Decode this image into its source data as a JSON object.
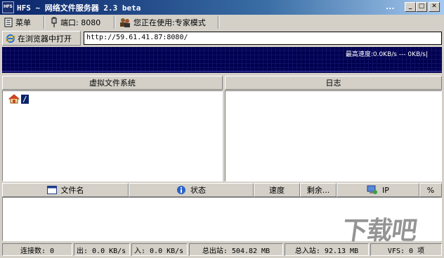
{
  "window": {
    "icon_label": "HFS",
    "title": "HFS ~ 网络文件服务器 2.3 beta",
    "dots": "...",
    "min_glyph": "_",
    "max_glyph": "□",
    "close_glyph": "✕"
  },
  "toolbar": {
    "menu": "菜单",
    "port": "端口: 8080",
    "mode": "您正在使用:专家模式"
  },
  "urlbar": {
    "open_browser": "在浏览器中打开",
    "url": "http://59.61.41.87:8080/"
  },
  "graph": {
    "speed_text": "最高速度:0.0KB/s  ---  0KB/s|"
  },
  "vfs": {
    "header": "虚拟文件系统",
    "root": "/"
  },
  "log": {
    "header": "日志"
  },
  "list": {
    "columns": [
      "文件名",
      "状态",
      "速度",
      "剩余...",
      "IP",
      "%"
    ]
  },
  "status": {
    "connections": "连接数: 0",
    "out": "出: 0.0 KB/s",
    "in": "入: 0.0 KB/s",
    "total_out": "总出站: 504.82 MB",
    "total_in": "总入站: 92.13 MB",
    "vfs_items": "VFS: 0 项"
  },
  "watermark": "下载吧"
}
